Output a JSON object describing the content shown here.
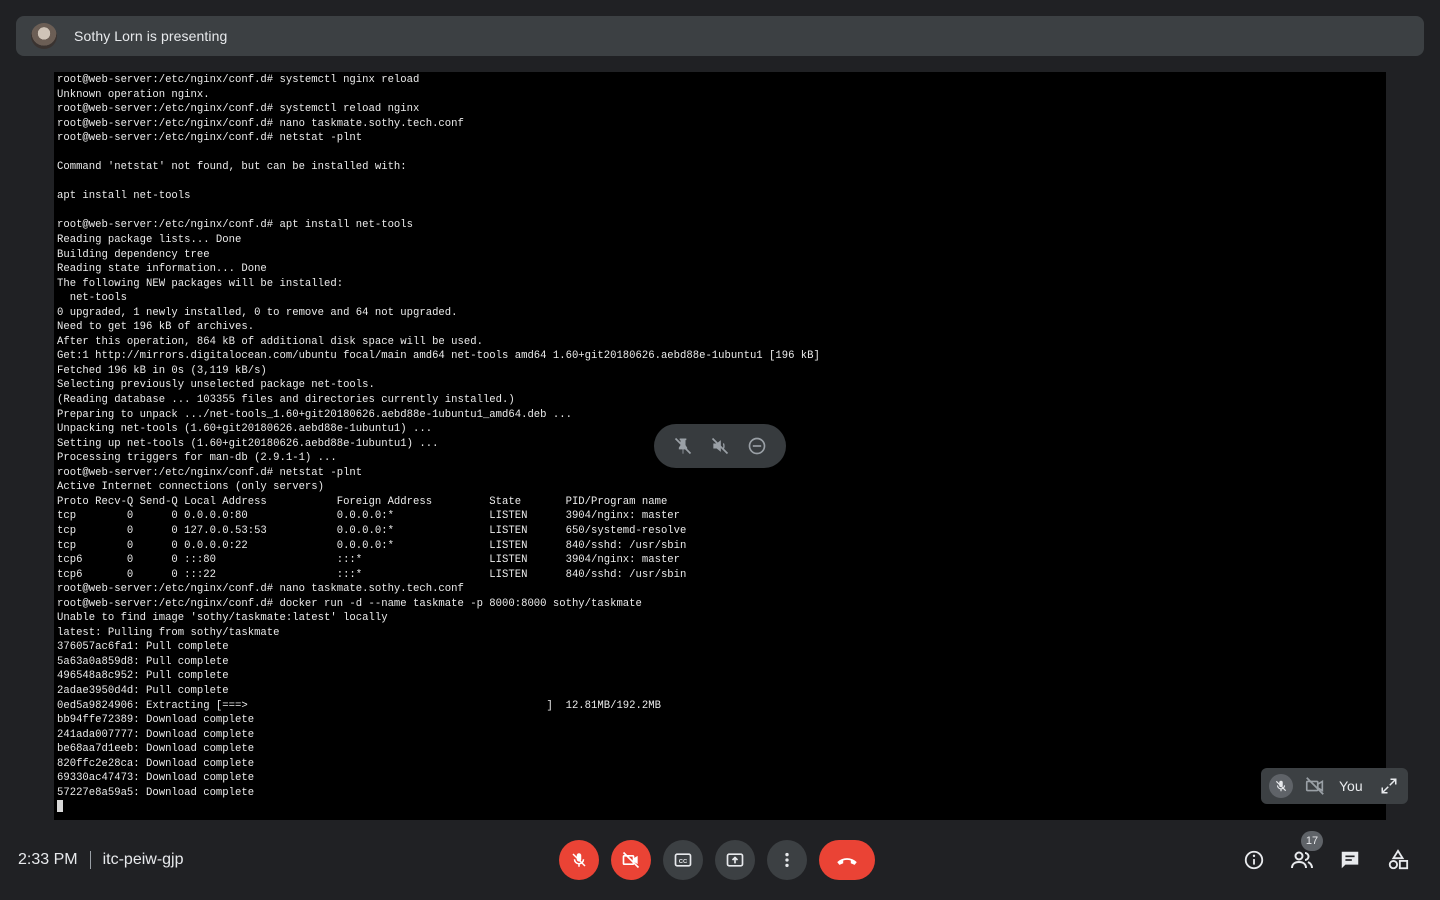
{
  "presenter_bar": {
    "text": "Sothy Lorn is presenting"
  },
  "terminal": {
    "lines": [
      "root@web-server:/etc/nginx/conf.d# systemctl nginx reload",
      "Unknown operation nginx.",
      "root@web-server:/etc/nginx/conf.d# systemctl reload nginx",
      "root@web-server:/etc/nginx/conf.d# nano taskmate.sothy.tech.conf",
      "root@web-server:/etc/nginx/conf.d# netstat -plnt",
      "",
      "Command 'netstat' not found, but can be installed with:",
      "",
      "apt install net-tools",
      "",
      "root@web-server:/etc/nginx/conf.d# apt install net-tools",
      "Reading package lists... Done",
      "Building dependency tree",
      "Reading state information... Done",
      "The following NEW packages will be installed:",
      "  net-tools",
      "0 upgraded, 1 newly installed, 0 to remove and 64 not upgraded.",
      "Need to get 196 kB of archives.",
      "After this operation, 864 kB of additional disk space will be used.",
      "Get:1 http://mirrors.digitalocean.com/ubuntu focal/main amd64 net-tools amd64 1.60+git20180626.aebd88e-1ubuntu1 [196 kB]",
      "Fetched 196 kB in 0s (3,119 kB/s)",
      "Selecting previously unselected package net-tools.",
      "(Reading database ... 103355 files and directories currently installed.)",
      "Preparing to unpack .../net-tools_1.60+git20180626.aebd88e-1ubuntu1_amd64.deb ...",
      "Unpacking net-tools (1.60+git20180626.aebd88e-1ubuntu1) ...",
      "Setting up net-tools (1.60+git20180626.aebd88e-1ubuntu1) ...",
      "Processing triggers for man-db (2.9.1-1) ...",
      "root@web-server:/etc/nginx/conf.d# netstat -plnt",
      "Active Internet connections (only servers)",
      "Proto Recv-Q Send-Q Local Address           Foreign Address         State       PID/Program name",
      "tcp        0      0 0.0.0.0:80              0.0.0.0:*               LISTEN      3904/nginx: master",
      "tcp        0      0 127.0.0.53:53           0.0.0.0:*               LISTEN      650/systemd-resolve",
      "tcp        0      0 0.0.0.0:22              0.0.0.0:*               LISTEN      840/sshd: /usr/sbin",
      "tcp6       0      0 :::80                   :::*                    LISTEN      3904/nginx: master",
      "tcp6       0      0 :::22                   :::*                    LISTEN      840/sshd: /usr/sbin",
      "root@web-server:/etc/nginx/conf.d# nano taskmate.sothy.tech.conf",
      "root@web-server:/etc/nginx/conf.d# docker run -d --name taskmate -p 8000:8000 sothy/taskmate",
      "Unable to find image 'sothy/taskmate:latest' locally",
      "latest: Pulling from sothy/taskmate",
      "376057ac6fa1: Pull complete",
      "5a63a0a859d8: Pull complete",
      "496548a8c952: Pull complete",
      "2adae3950d4d: Pull complete",
      "0ed5a9824906: Extracting [===>                                               ]  12.81MB/192.2MB",
      "bb94ffe72389: Download complete",
      "241ada007777: Download complete",
      "be68aa7d1eeb: Download complete",
      "820ffc2e28ca: Download complete",
      "69330ac47473: Download complete",
      "57227e8a59a5: Download complete"
    ]
  },
  "self_view": {
    "label": "You"
  },
  "meeting": {
    "time": "2:33 PM",
    "code": "itc-peiw-gjp"
  },
  "participants": {
    "count": "17"
  },
  "icons": {
    "unpin": "unpin-icon",
    "mute_remote": "volume-off-icon",
    "remove": "remove-icon",
    "mic_off": "mic-off-icon",
    "camera_off": "videocam-off-icon",
    "captions": "closed-caption-icon",
    "present": "present-screen-icon",
    "more": "more-vert-icon",
    "hang_up": "call-end-icon",
    "info": "info-icon",
    "people": "people-icon",
    "chat": "chat-icon",
    "activities": "activities-icon",
    "expand": "expand-icon"
  },
  "colors": {
    "background": "#202124",
    "surface": "#3c4043",
    "danger": "#ea4335",
    "terminal_bg": "#000000"
  }
}
